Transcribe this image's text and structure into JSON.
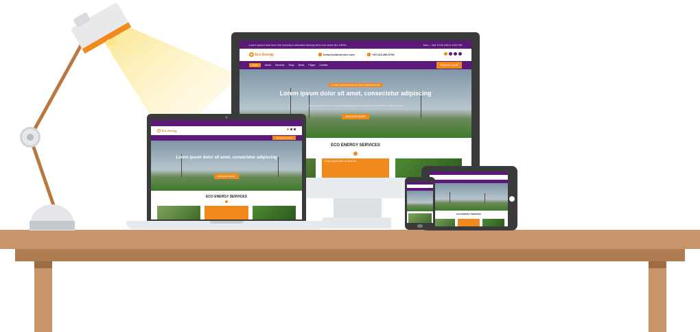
{
  "website": {
    "topbar_text": "Lorem Ipsum has been the industry's standard dummy text ever since the 1500s",
    "topbar_hours": "Mon – Sat 10:00 AM to 6:00 PM",
    "logo": "Eco Energy",
    "email": "hello@solarservice.com",
    "phone": "+00 123-456-6790",
    "nav": [
      "Home",
      "About",
      "Services",
      "Shop",
      "News",
      "Pages",
      "Contact"
    ],
    "quote_button": "Request a quote",
    "hero_badge": "LOREM IPSUM DOLOR SIT AMET CONSECTETUR",
    "hero_title": "Lorem ipsum dolor sit amet, consectetur adipiscing",
    "hero_sub": "Lorem ipsum dolor sit amet, consectetur adipiscing sed do eiusmod tempor incididunt ut labore et dolore",
    "hero_button": "DISCOVER MORE",
    "section_title": "ECO ENERGY SERVICES",
    "card_text": "Lorem ipsum dolor sit amet co..."
  },
  "colors": {
    "purple": "#5b1a7a",
    "orange": "#f08a1c",
    "desk": "#c8956a",
    "device_frame": "#3a3a3a",
    "lamp_shade": "#e8e9eb",
    "lamp_arm": "#b9783f"
  }
}
